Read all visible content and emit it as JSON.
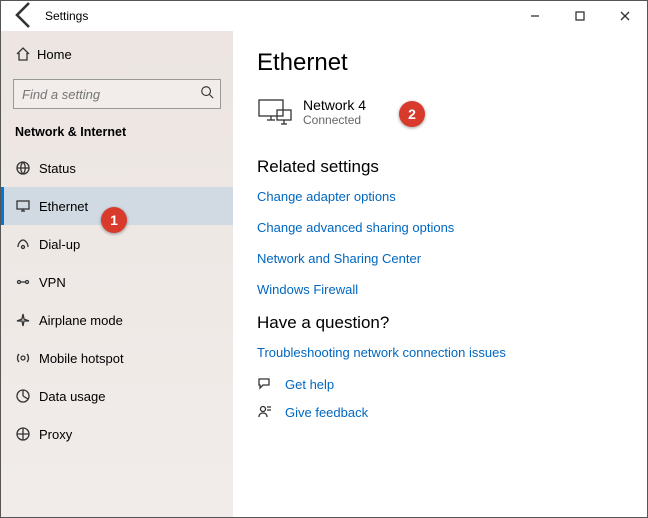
{
  "titlebar": {
    "title": "Settings"
  },
  "sidebar": {
    "home": "Home",
    "search_placeholder": "Find a setting",
    "section": "Network & Internet",
    "items": [
      {
        "label": "Status"
      },
      {
        "label": "Ethernet"
      },
      {
        "label": "Dial-up"
      },
      {
        "label": "VPN"
      },
      {
        "label": "Airplane mode"
      },
      {
        "label": "Mobile hotspot"
      },
      {
        "label": "Data usage"
      },
      {
        "label": "Proxy"
      }
    ]
  },
  "main": {
    "title": "Ethernet",
    "network": {
      "name": "Network 4",
      "status": "Connected"
    },
    "related_head": "Related settings",
    "links": [
      "Change adapter options",
      "Change advanced sharing options",
      "Network and Sharing Center",
      "Windows Firewall"
    ],
    "question_head": "Have a question?",
    "troubleshoot": "Troubleshooting network connection issues",
    "get_help": "Get help",
    "give_feedback": "Give feedback"
  },
  "annotations": {
    "1": "1",
    "2": "2"
  }
}
